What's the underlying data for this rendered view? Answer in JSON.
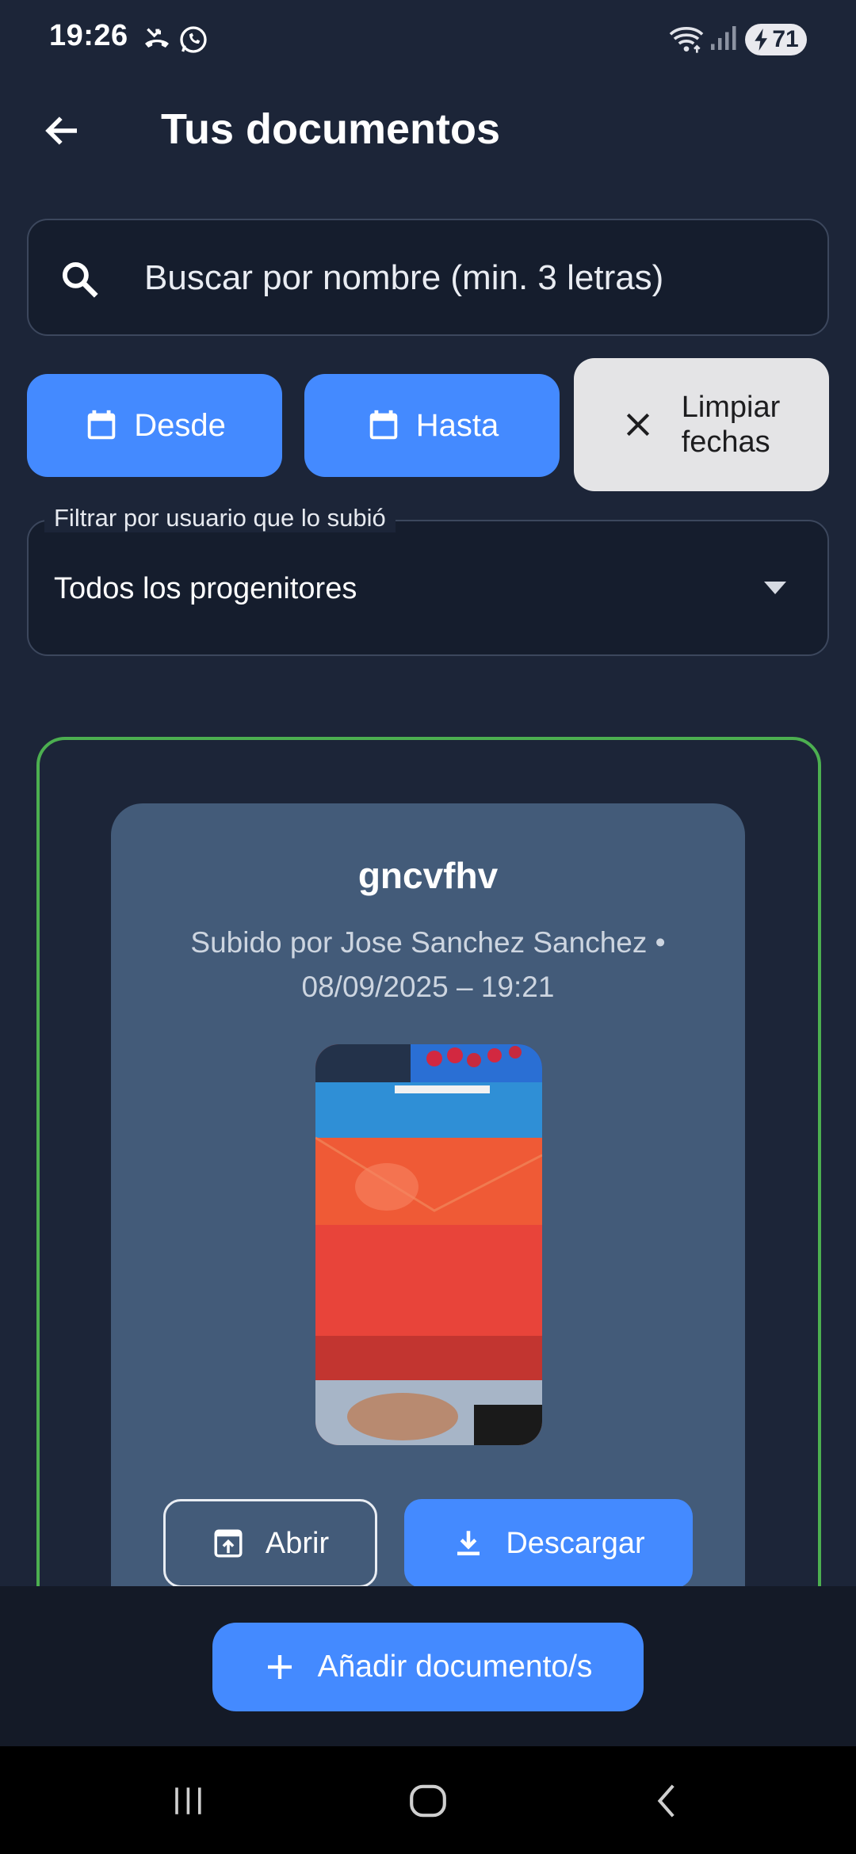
{
  "status_bar": {
    "time": "19:26",
    "battery_level": "71",
    "icons": [
      "missed-call-icon",
      "whatsapp-icon",
      "wifi-icon",
      "signal-icon",
      "battery-charging-icon"
    ]
  },
  "app_bar": {
    "title": "Tus documentos",
    "back_icon": "arrow-back-icon"
  },
  "search": {
    "placeholder": "Buscar por nombre (min. 3 letras)",
    "value": "",
    "icon": "search-icon"
  },
  "date_filters": {
    "from_label": "Desde",
    "to_label": "Hasta",
    "clear_label_line1": "Limpiar",
    "clear_label_line2": "fechas",
    "icons": [
      "calendar-icon",
      "close-icon"
    ]
  },
  "user_filter": {
    "label": "Filtrar por usuario que lo subió",
    "selected": "Todos los progenitores",
    "icon": "dropdown-arrow-icon"
  },
  "documents": [
    {
      "name": "gncvfhv",
      "meta_line1": "Subido por Jose Sanchez Sanchez •",
      "meta_line2": "08/09/2025 – 19:21",
      "open_label": "Abrir",
      "download_label": "Descargar",
      "selected": true
    }
  ],
  "bottom": {
    "add_label": "Añadir documento/s"
  },
  "colors": {
    "background": "#1c2538",
    "field_background": "#151d2d",
    "accent": "#448aff",
    "card": "#435b79",
    "selection_border": "#4caf50",
    "clear_button": "#e4e4e6"
  }
}
